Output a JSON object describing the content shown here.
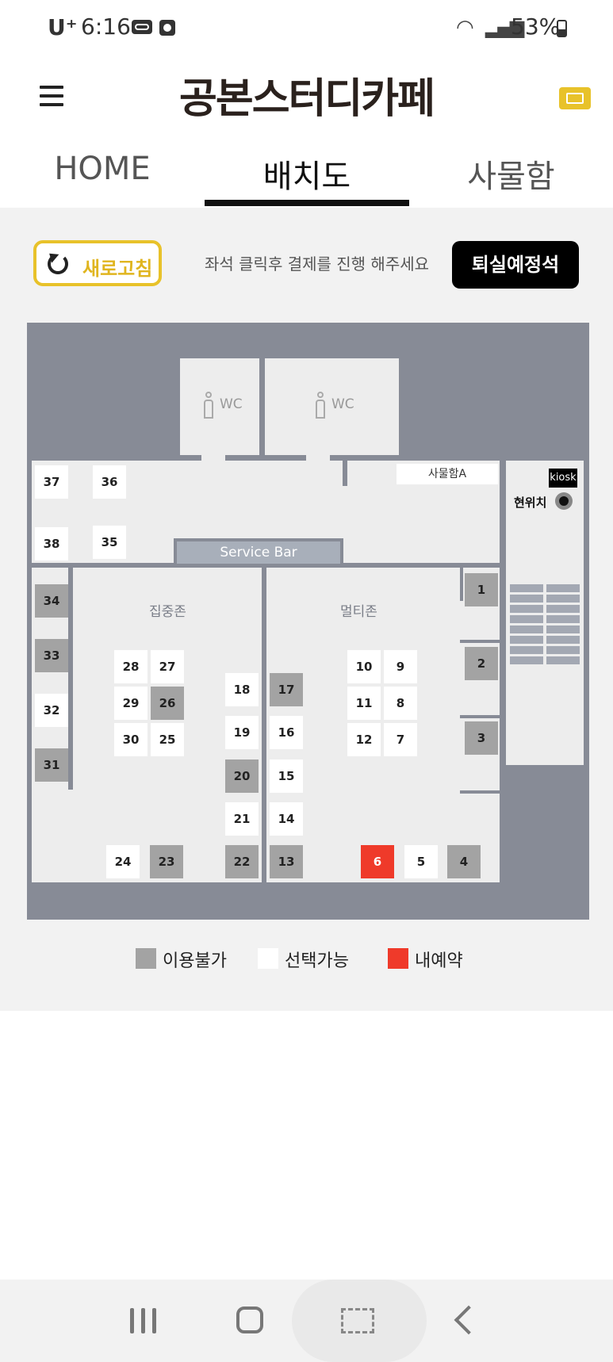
{
  "status_bar": {
    "carrier": "U⁺",
    "time": "6:16",
    "battery": "53%"
  },
  "header": {
    "brand": "공본스터디카페"
  },
  "tabs": [
    {
      "label": "HOME"
    },
    {
      "label": "배치도"
    },
    {
      "label": "사물함"
    }
  ],
  "active_tab": "배치도",
  "toolbar": {
    "refresh_label": "새로고침",
    "guide_text": "좌석 클릭후 결제를 진행 해주세요",
    "leave_label": "퇴실예정석"
  },
  "map": {
    "wc_label": "WC",
    "service_bar": "Service Bar",
    "locker_area": "사물함A",
    "kiosk": "kiosk",
    "current_location": "현위치",
    "zone_focus": "집중존",
    "zone_multi": "멀티존"
  },
  "seats": {
    "s1": "1",
    "s2": "2",
    "s3": "3",
    "s4": "4",
    "s5": "5",
    "s6": "6",
    "s7": "7",
    "s8": "8",
    "s9": "9",
    "s10": "10",
    "s11": "11",
    "s12": "12",
    "s13": "13",
    "s14": "14",
    "s15": "15",
    "s16": "16",
    "s17": "17",
    "s18": "18",
    "s19": "19",
    "s20": "20",
    "s21": "21",
    "s22": "22",
    "s23": "23",
    "s24": "24",
    "s25": "25",
    "s26": "26",
    "s27": "27",
    "s28": "28",
    "s29": "29",
    "s30": "30",
    "s31": "31",
    "s32": "32",
    "s33": "33",
    "s34": "34",
    "s35": "35",
    "s36": "36",
    "s37": "37",
    "s38": "38"
  },
  "legend": {
    "unavailable": "이용불가",
    "available": "선택가능",
    "mine": "내예약"
  },
  "colors": {
    "accent": "#e8c22a",
    "unavailable": "#a3a3a3",
    "available": "#ffffff",
    "mine": "#ef3a2a",
    "map_wall": "#878b96"
  }
}
